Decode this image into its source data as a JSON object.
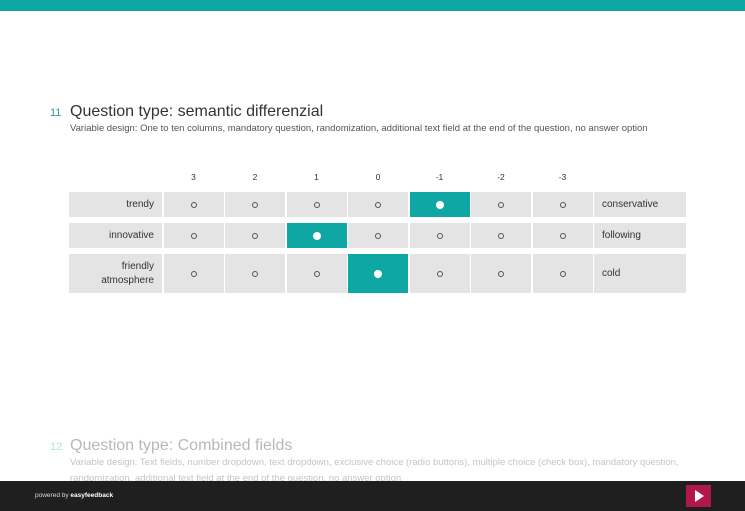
{
  "question11": {
    "number": "11",
    "title": "Question type: semantic differenzial",
    "description": "Variable design: One to ten columns, mandatory question, randomization, additional text field at the end of the question, no answer option",
    "columns": [
      "3",
      "2",
      "1",
      "0",
      "-1",
      "-2",
      "-3"
    ],
    "rows": [
      {
        "left": "trendy",
        "right": "conservative",
        "selected_index": 4
      },
      {
        "left": "innovative",
        "right": "following",
        "selected_index": 2
      },
      {
        "left": "friendly atmosphere",
        "right": "cold",
        "selected_index": 3
      }
    ]
  },
  "question12": {
    "number": "12",
    "title": "Question type: Combined fields",
    "description": "Variable design: Text fields, number dropdown, text dropdown, exclusive choice (radio buttons), multiple choice (check box), mandatory question, randomization, additional text field at the end of the question, no answer option"
  },
  "footer": {
    "powered_prefix": "powered by",
    "brand": "easyfeedback"
  },
  "colors": {
    "accent": "#0fa7a3",
    "next_button": "#b0174a",
    "cell_bg": "#e4e4e4",
    "footer_bg": "#1f1f1f"
  },
  "icons": {
    "next": "play-icon"
  }
}
